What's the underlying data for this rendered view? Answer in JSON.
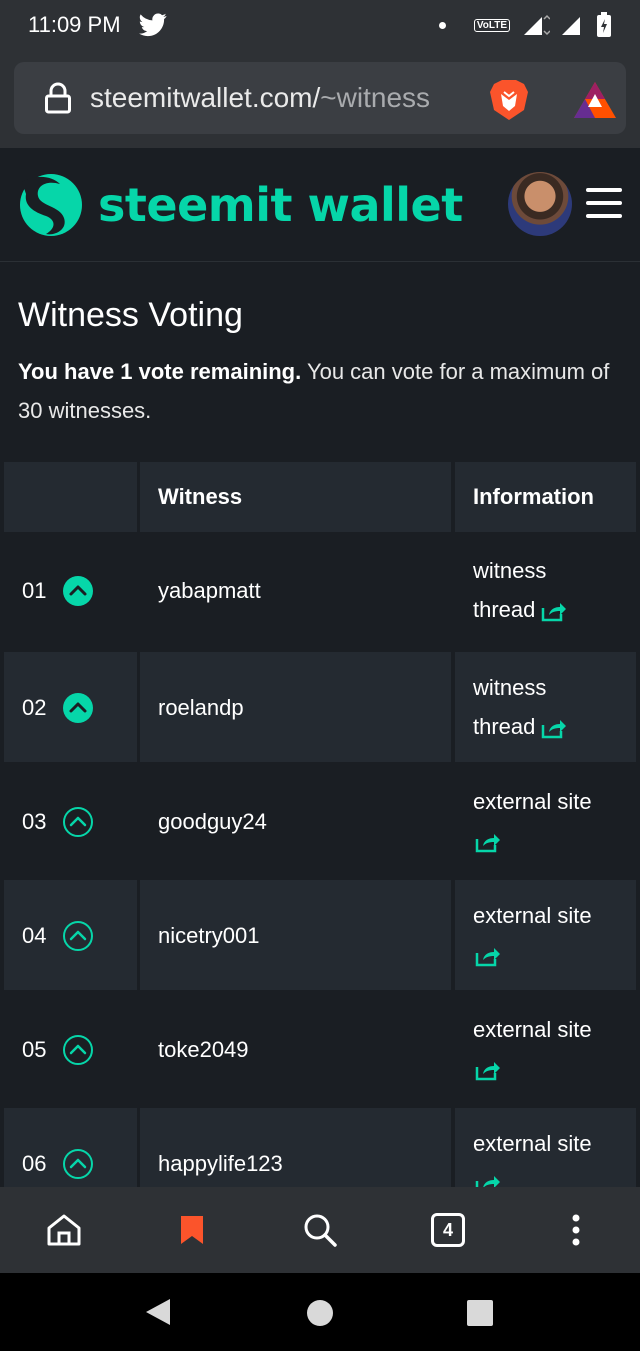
{
  "status_bar": {
    "time": "11:09 PM",
    "network": "VoLTE"
  },
  "browser": {
    "url_main": "steemitwallet.com/",
    "url_path": "~witness",
    "tab_count": "4"
  },
  "site": {
    "name": "steemit wallet",
    "brand_color": "#06d6a9"
  },
  "page": {
    "title": "Witness Voting",
    "intro_bold": "You have 1 vote remaining.",
    "intro_rest": " You can vote for a maximum of 30 witnesses."
  },
  "table": {
    "headers": [
      "",
      "Witness",
      "Information"
    ],
    "rows": [
      {
        "rank": "01",
        "voted": true,
        "witness": "yabapmatt",
        "info_line1": "witness",
        "info_line2": "thread"
      },
      {
        "rank": "02",
        "voted": true,
        "witness": "roelandp",
        "info_line1": "witness",
        "info_line2": "thread"
      },
      {
        "rank": "03",
        "voted": false,
        "witness": "goodguy24",
        "info_line1": "external site",
        "info_line2": ""
      },
      {
        "rank": "04",
        "voted": false,
        "witness": "nicetry001",
        "info_line1": "external site",
        "info_line2": ""
      },
      {
        "rank": "05",
        "voted": false,
        "witness": "toke2049",
        "info_line1": "external site",
        "info_line2": ""
      },
      {
        "rank": "06",
        "voted": false,
        "witness": "happylife123",
        "info_line1": "external site",
        "info_line2": ""
      }
    ]
  },
  "icons": {
    "status": [
      "twitter-icon",
      "volte-icon",
      "signal-icon",
      "battery-icon"
    ],
    "browser": [
      "lock-icon",
      "brave-lion-icon",
      "bat-rewards-icon"
    ],
    "bottom_nav": [
      "home-icon",
      "bookmark-icon",
      "search-icon",
      "tabs-icon",
      "more-icon"
    ],
    "system_nav": [
      "back-icon",
      "home-circle-icon",
      "recents-icon"
    ]
  }
}
